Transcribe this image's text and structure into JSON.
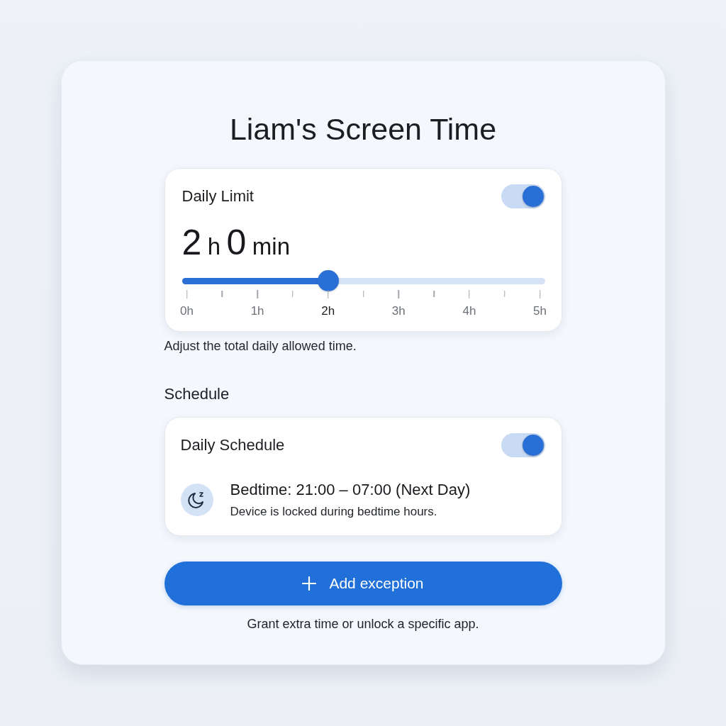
{
  "title": "Liam's Screen Time",
  "daily_limit": {
    "label": "Daily Limit",
    "on": true,
    "value": [
      {
        "kind": "number",
        "text": "2"
      },
      {
        "kind": "unit",
        "text": "h"
      },
      {
        "kind": "number",
        "text": "0"
      },
      {
        "kind": "unit",
        "text": "min"
      }
    ],
    "slider": {
      "level": 0.4,
      "scale": [
        {
          "label": "0h",
          "selected": false
        },
        {
          "label": "1h",
          "selected": false
        },
        {
          "label": "2h",
          "selected": true
        },
        {
          "label": "3h",
          "selected": false
        },
        {
          "label": "4h",
          "selected": false
        },
        {
          "label": "5h",
          "selected": false
        }
      ]
    },
    "hint": "Adjust the total daily allowed time."
  },
  "schedule": {
    "heading": "Schedule",
    "card": {
      "label": "Daily Schedule",
      "on": true,
      "items": [
        {
          "title": "Bedtime: 21:00 – 07:00 (Next Day)",
          "description": "Device is locked during bedtime hours."
        }
      ]
    }
  },
  "action": {
    "button": "Add exception",
    "hint": "Grant extra time or unlock a specific app."
  }
}
